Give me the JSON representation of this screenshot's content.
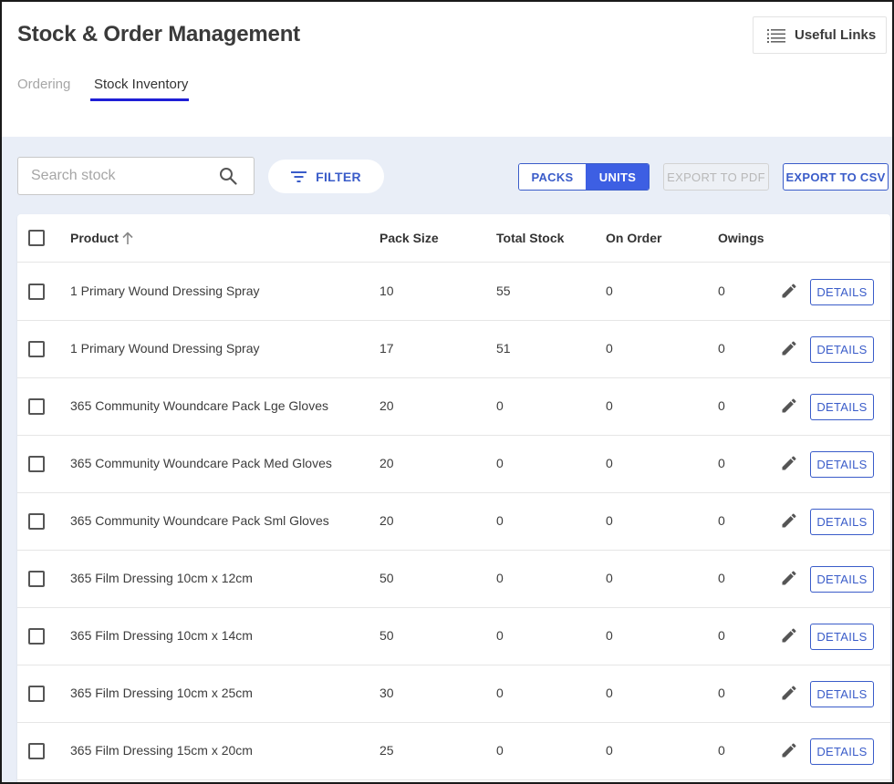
{
  "header": {
    "title": "Stock & Order Management",
    "useful_links_label": "Useful Links",
    "useful_links_icon": "list-icon"
  },
  "tabs": [
    {
      "label": "Ordering",
      "active": false
    },
    {
      "label": "Stock Inventory",
      "active": true
    }
  ],
  "toolbar": {
    "search_placeholder": "Search stock",
    "search_value": "",
    "filter_label": "FILTER",
    "toggle_packs_label": "PACKS",
    "toggle_units_label": "UNITS",
    "toggle_selected": "UNITS",
    "export_pdf_label": "EXPORT TO PDF",
    "export_pdf_enabled": false,
    "export_csv_label": "EXPORT TO CSV"
  },
  "table": {
    "headers": {
      "product": "Product",
      "pack_size": "Pack Size",
      "total_stock": "Total Stock",
      "on_order": "On Order",
      "owings": "Owings"
    },
    "sort": {
      "column": "Product",
      "direction": "ascending"
    },
    "details_label": "DETAILS",
    "rows": [
      {
        "product": "1 Primary Wound Dressing Spray",
        "pack_size": "10",
        "total_stock": "55",
        "on_order": "0",
        "owings": "0"
      },
      {
        "product": "1 Primary Wound Dressing Spray",
        "pack_size": "17",
        "total_stock": "51",
        "on_order": "0",
        "owings": "0"
      },
      {
        "product": "365 Community Woundcare Pack Lge Gloves",
        "pack_size": "20",
        "total_stock": "0",
        "on_order": "0",
        "owings": "0"
      },
      {
        "product": "365 Community Woundcare Pack Med Gloves",
        "pack_size": "20",
        "total_stock": "0",
        "on_order": "0",
        "owings": "0"
      },
      {
        "product": "365 Community Woundcare Pack Sml Gloves",
        "pack_size": "20",
        "total_stock": "0",
        "on_order": "0",
        "owings": "0"
      },
      {
        "product": "365 Film Dressing 10cm x 12cm",
        "pack_size": "50",
        "total_stock": "0",
        "on_order": "0",
        "owings": "0"
      },
      {
        "product": "365 Film Dressing 10cm x 14cm",
        "pack_size": "50",
        "total_stock": "0",
        "on_order": "0",
        "owings": "0"
      },
      {
        "product": "365 Film Dressing 10cm x 25cm",
        "pack_size": "30",
        "total_stock": "0",
        "on_order": "0",
        "owings": "0"
      },
      {
        "product": "365 Film Dressing 15cm x 20cm",
        "pack_size": "25",
        "total_stock": "0",
        "on_order": "0",
        "owings": "0"
      }
    ]
  },
  "colors": {
    "accent": "#3d5fe3",
    "tab_underline": "#1f1fd6",
    "content_background": "#e9eef7"
  }
}
